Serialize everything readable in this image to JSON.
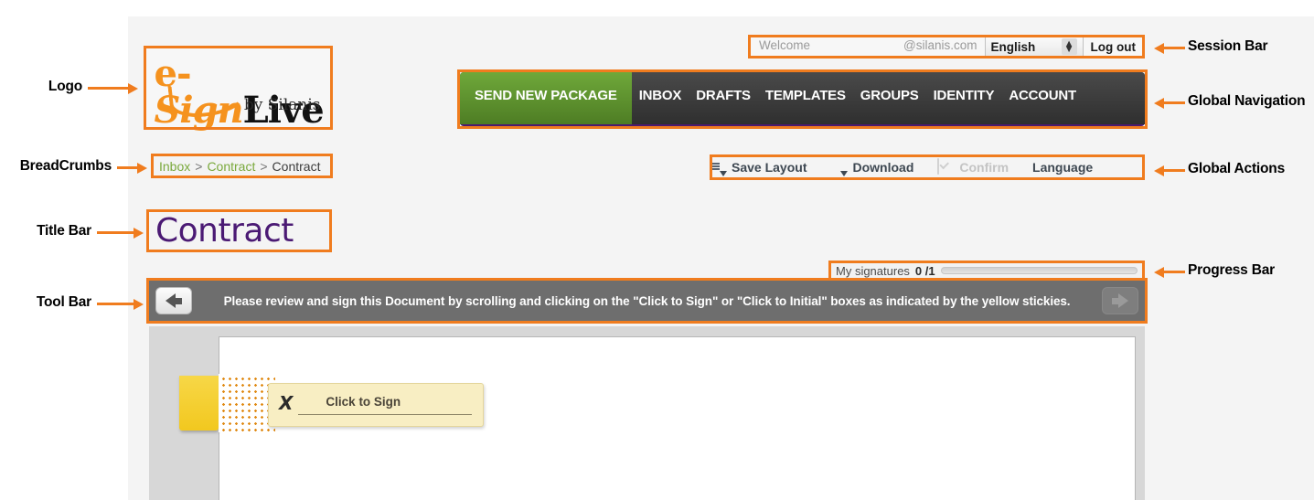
{
  "annotations": {
    "left": [
      {
        "id": "logo",
        "label": "Logo"
      },
      {
        "id": "breadcrumbs",
        "label": "BreadCrumbs"
      },
      {
        "id": "title-bar",
        "label": "Title Bar"
      },
      {
        "id": "tool-bar",
        "label": "Tool Bar"
      }
    ],
    "right": [
      {
        "id": "session-bar",
        "label": "Session Bar"
      },
      {
        "id": "global-navigation",
        "label": "Global Navigation"
      },
      {
        "id": "global-actions",
        "label": "Global Actions"
      },
      {
        "id": "progress-bar",
        "label": "Progress Bar"
      }
    ]
  },
  "logo": {
    "part_e": "e-",
    "part_sign": "Sign",
    "part_live": "Live",
    "tagline": "by Silanis"
  },
  "session_bar": {
    "welcome": "Welcome",
    "account_domain": "@silanis.com",
    "language_value": "English",
    "stepper_icon": "stepper-up-down-icon",
    "logout": "Log out"
  },
  "global_nav": {
    "primary": "SEND NEW PACKAGE",
    "items": [
      {
        "label": "INBOX"
      },
      {
        "label": "DRAFTS"
      },
      {
        "label": "TEMPLATES"
      },
      {
        "label": "GROUPS"
      },
      {
        "label": "IDENTITY"
      },
      {
        "label": "ACCOUNT"
      }
    ]
  },
  "breadcrumbs": {
    "items": [
      {
        "label": "Inbox",
        "current": false
      },
      {
        "label": "Contract",
        "current": false
      },
      {
        "label": "Contract",
        "current": true
      }
    ],
    "separator": ">"
  },
  "global_actions": {
    "save_layout": "Save Layout",
    "save_layout_icon": "save-layout-icon",
    "download": "Download",
    "download_icon": "download-document-icon",
    "confirm": "Confirm",
    "confirm_icon": "confirm-checkbox-icon",
    "language": "Language"
  },
  "title_bar": {
    "title": "Contract"
  },
  "progress_bar": {
    "label": "My signatures",
    "count": "0 /1",
    "completed": 0,
    "total": 1,
    "percent": 0
  },
  "toolbar": {
    "prev_icon": "arrow-left-icon",
    "next_icon": "arrow-right-icon",
    "message_part1": "Please review and sign this Document by scrolling and clicking on the ",
    "message_quote1": "\"Click to Sign\"",
    "message_part2": " or ",
    "message_quote2": "\"Click to Initial\"",
    "message_part3": " boxes as indicated by the yellow stickies."
  },
  "document": {
    "sign_box_label": "Click to Sign",
    "sign_box_mark": "X",
    "sticky_icon": "yellow-sticky-tab-icon"
  },
  "colors": {
    "accent_orange": "#f07c1e",
    "brand_orange": "#f5921e",
    "brand_purple": "#4b1a74",
    "nav_green": "#5d9330",
    "nav_dark": "#3a3a3a",
    "crumb_green": "#7aa93c",
    "toolbar_gray": "#6e6e6e",
    "sticky_yellow": "#f2c81f",
    "sign_box_cream": "#f8eec3"
  }
}
